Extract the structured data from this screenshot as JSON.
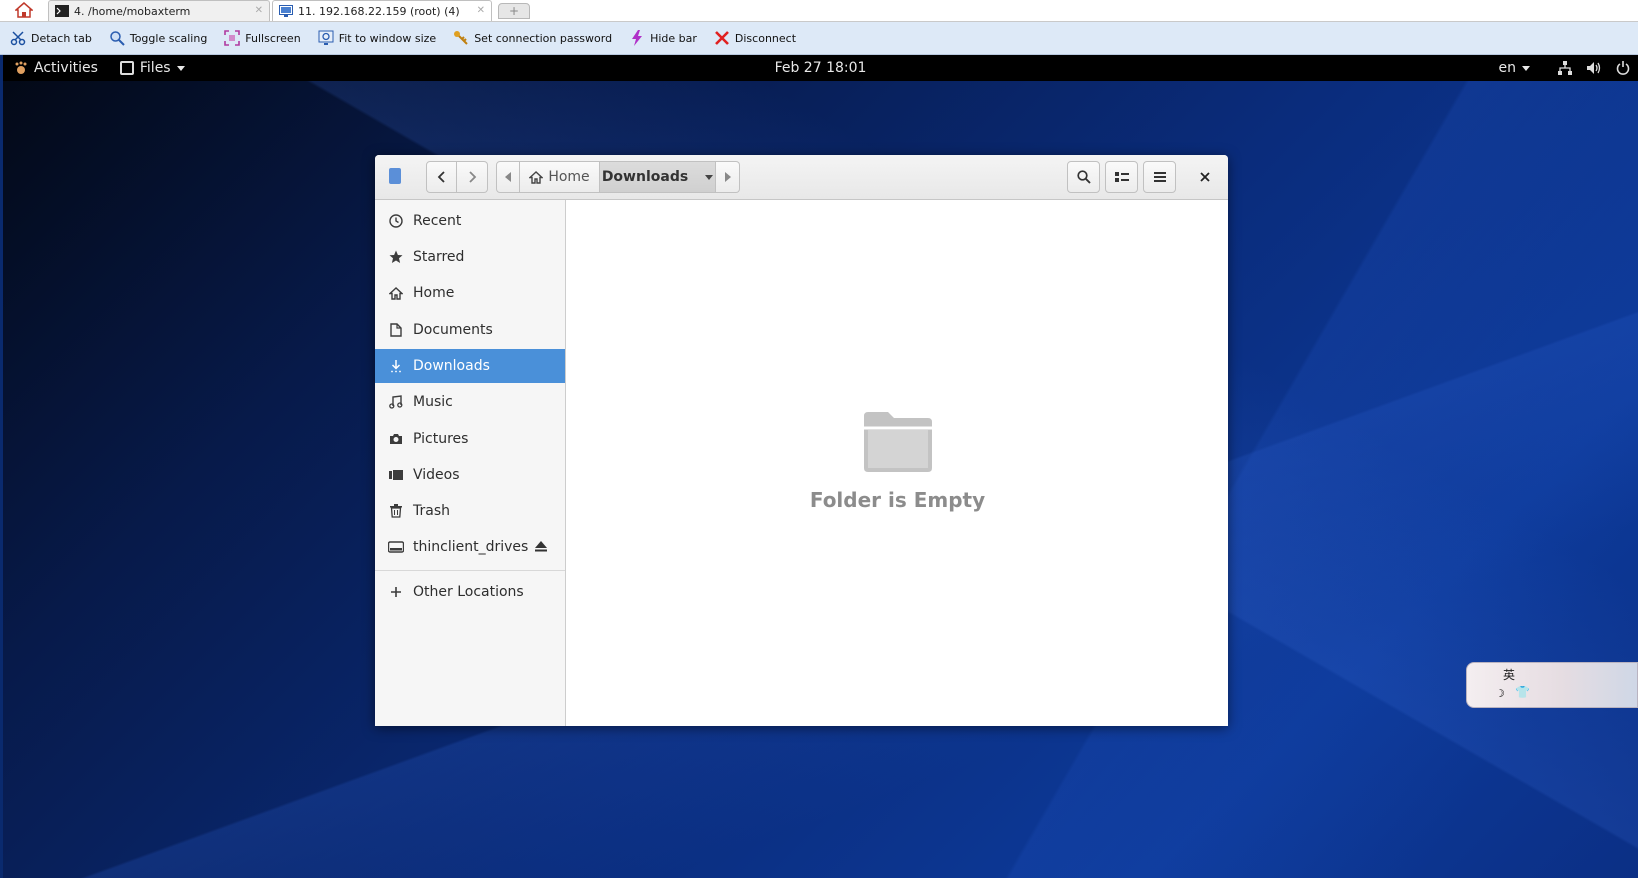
{
  "moba": {
    "tabs": [
      {
        "label": "4. /home/mobaxterm",
        "active": false
      },
      {
        "label": "11. 192.168.22.159 (root) (4)",
        "active": true
      }
    ],
    "toolbar": [
      {
        "label": "Detach tab",
        "icon": "scissors-icon"
      },
      {
        "label": "Toggle scaling",
        "icon": "magnifier-icon"
      },
      {
        "label": "Fullscreen",
        "icon": "fullscreen-icon"
      },
      {
        "label": "Fit to window size",
        "icon": "fit-window-icon"
      },
      {
        "label": "Set connection password",
        "icon": "key-icon"
      },
      {
        "label": "Hide bar",
        "icon": "lightning-icon"
      },
      {
        "label": "Disconnect",
        "icon": "red-x-icon"
      }
    ]
  },
  "gnome": {
    "activities": "Activities",
    "app_menu": "Files",
    "clock": "Feb 27  18:01",
    "lang": "en"
  },
  "nautilus": {
    "path": {
      "home": "Home",
      "current": "Downloads"
    },
    "sidebar": [
      {
        "label": "Recent",
        "icon": "clock-icon"
      },
      {
        "label": "Starred",
        "icon": "star-icon"
      },
      {
        "label": "Home",
        "icon": "home-icon"
      },
      {
        "label": "Documents",
        "icon": "document-icon"
      },
      {
        "label": "Downloads",
        "icon": "download-icon",
        "active": true
      },
      {
        "label": "Music",
        "icon": "music-icon"
      },
      {
        "label": "Pictures",
        "icon": "camera-icon"
      },
      {
        "label": "Videos",
        "icon": "video-icon"
      },
      {
        "label": "Trash",
        "icon": "trash-icon"
      },
      {
        "label": "thinclient_drives",
        "icon": "drive-icon"
      }
    ],
    "other_locations": "Other Locations",
    "empty_text": "Folder is Empty"
  },
  "ime": {
    "char": "英"
  },
  "colors": {
    "accent": "#4a90d9",
    "toolbar_bg": "#dde9f7",
    "topbar_bg": "#000000"
  }
}
